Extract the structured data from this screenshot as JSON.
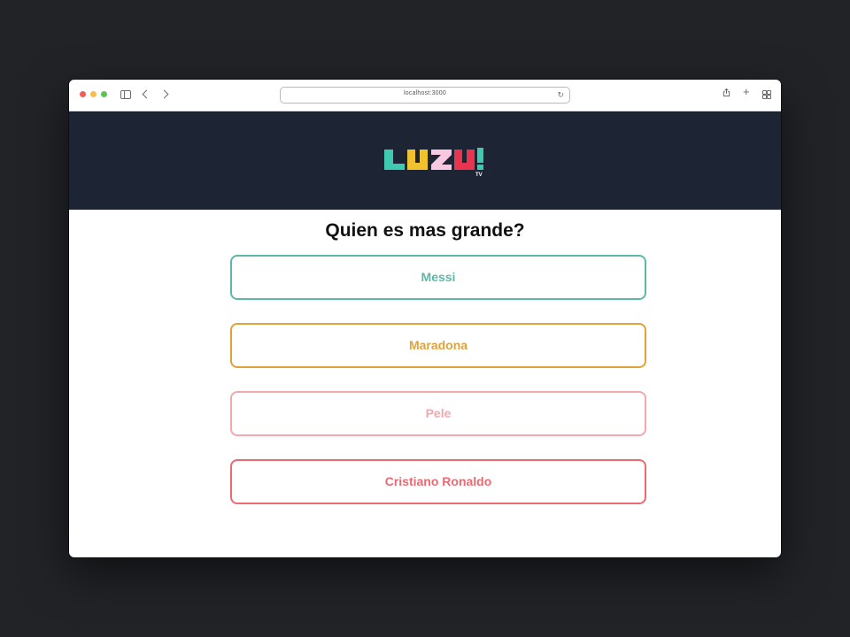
{
  "browser": {
    "url": "localhost:3000",
    "reload_glyph": "↻",
    "new_tab_glyph": "+"
  },
  "header": {
    "logo_letters": [
      "L",
      "U",
      "Z",
      "U",
      "!"
    ],
    "logo_sub": "TV",
    "logo_colors": [
      "#3ec9b0",
      "#f2c12e",
      "#f7c8e0",
      "#e8344f",
      "#3ec9b0"
    ]
  },
  "quiz": {
    "question": "Quien es mas grande?",
    "options": [
      {
        "label": "Messi",
        "color": "#5fb8a7"
      },
      {
        "label": "Maradona",
        "color": "#e2a23a"
      },
      {
        "label": "Pele",
        "color": "#f4a8ae"
      },
      {
        "label": "Cristiano Ronaldo",
        "color": "#ec6a72"
      }
    ]
  },
  "colors": {
    "background": "#212327",
    "header_bg": "#1d2433"
  }
}
